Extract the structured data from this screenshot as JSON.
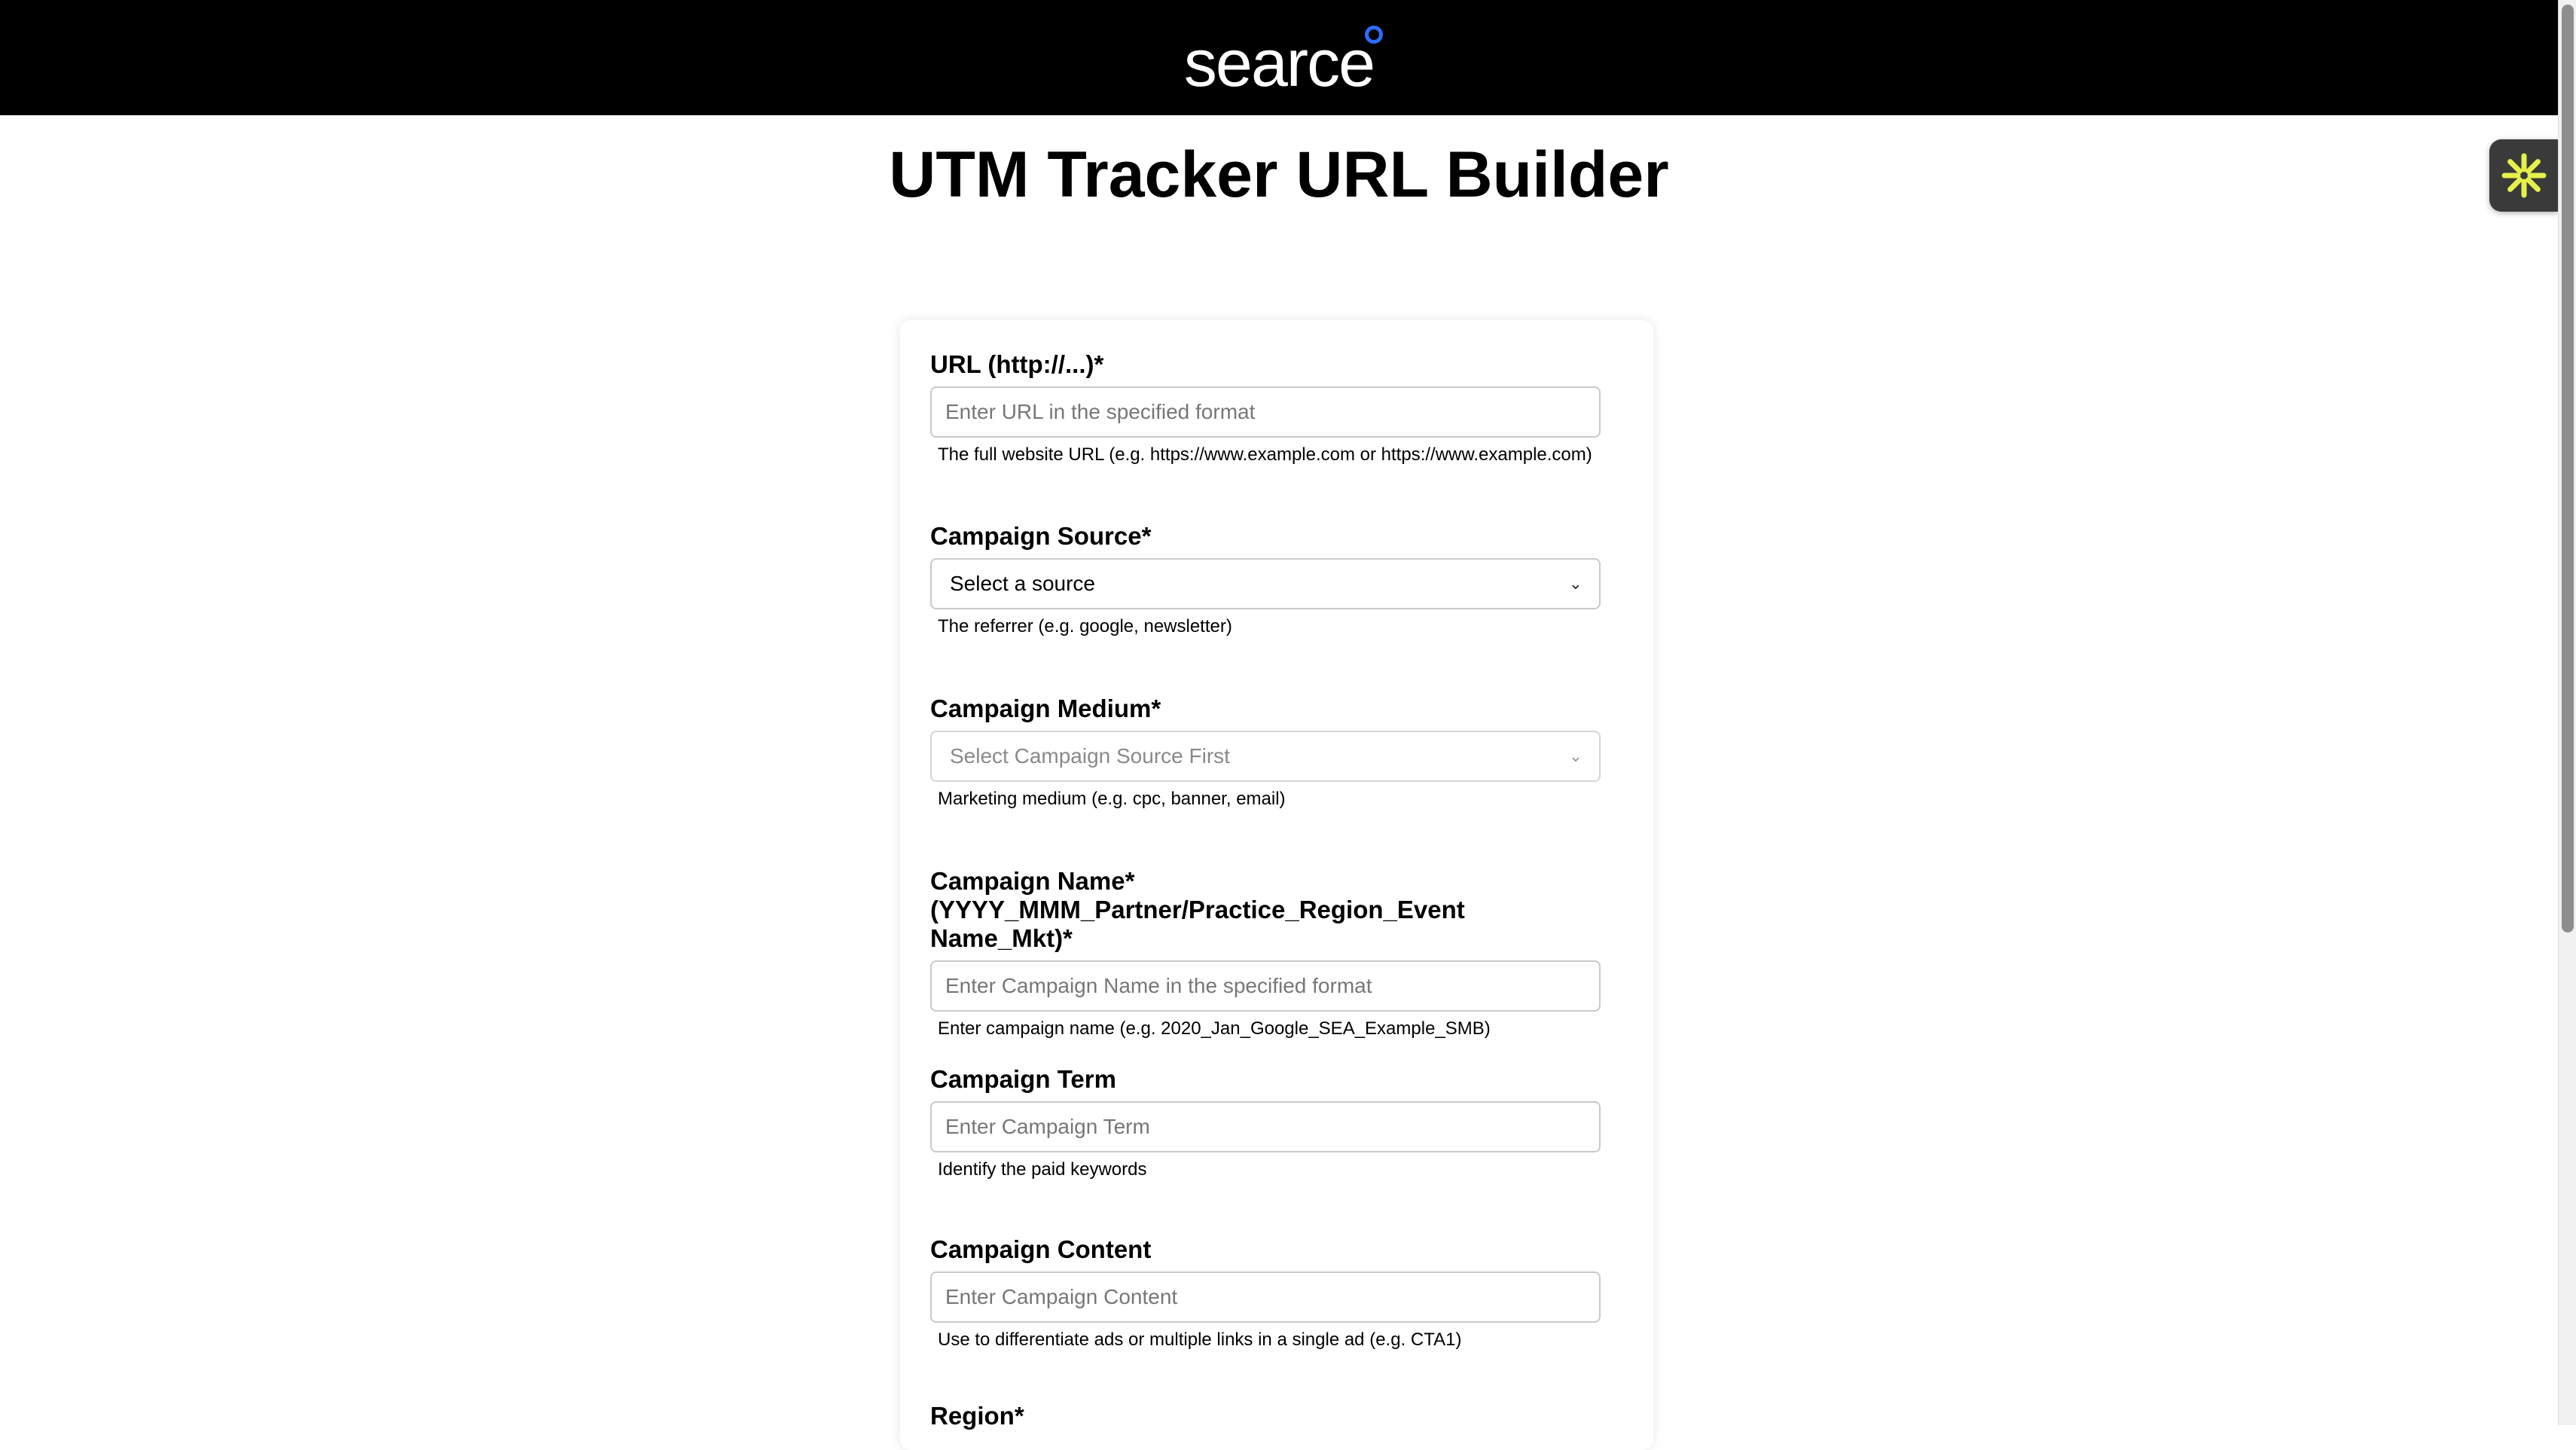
{
  "header": {
    "logo_text": "searce",
    "accent_color": "#2d6cff"
  },
  "page": {
    "title": "UTM Tracker URL Builder"
  },
  "form": {
    "url": {
      "label": "URL (http://...)*",
      "placeholder": "Enter URL in the specified format",
      "help": "The full website URL (e.g. https://www.example.com or https://www.example.com)"
    },
    "source": {
      "label": "Campaign Source*",
      "selected": "Select a source",
      "help": "The referrer (e.g. google, newsletter)"
    },
    "medium": {
      "label": "Campaign Medium*",
      "selected": "Select Campaign Source First",
      "help": "Marketing medium (e.g. cpc, banner, email)"
    },
    "name": {
      "label_line1": "Campaign Name*",
      "label_line2": "(YYYY_MMM_Partner/Practice_Region_Event Name_Mkt)*",
      "placeholder": "Enter Campaign Name in the specified format",
      "help": "Enter campaign name (e.g. 2020_Jan_Google_SEA_Example_SMB)"
    },
    "term": {
      "label": "Campaign Term",
      "placeholder": "Enter Campaign Term",
      "help": "Identify the paid keywords"
    },
    "content": {
      "label": "Campaign Content",
      "placeholder": "Enter Campaign Content",
      "help": "Use to differentiate ads or multiple links in a single ad (e.g. CTA1)"
    },
    "region": {
      "label": "Region*"
    }
  },
  "widget": {
    "icon": "asterisk-icon",
    "icon_color": "#e6f04a"
  }
}
